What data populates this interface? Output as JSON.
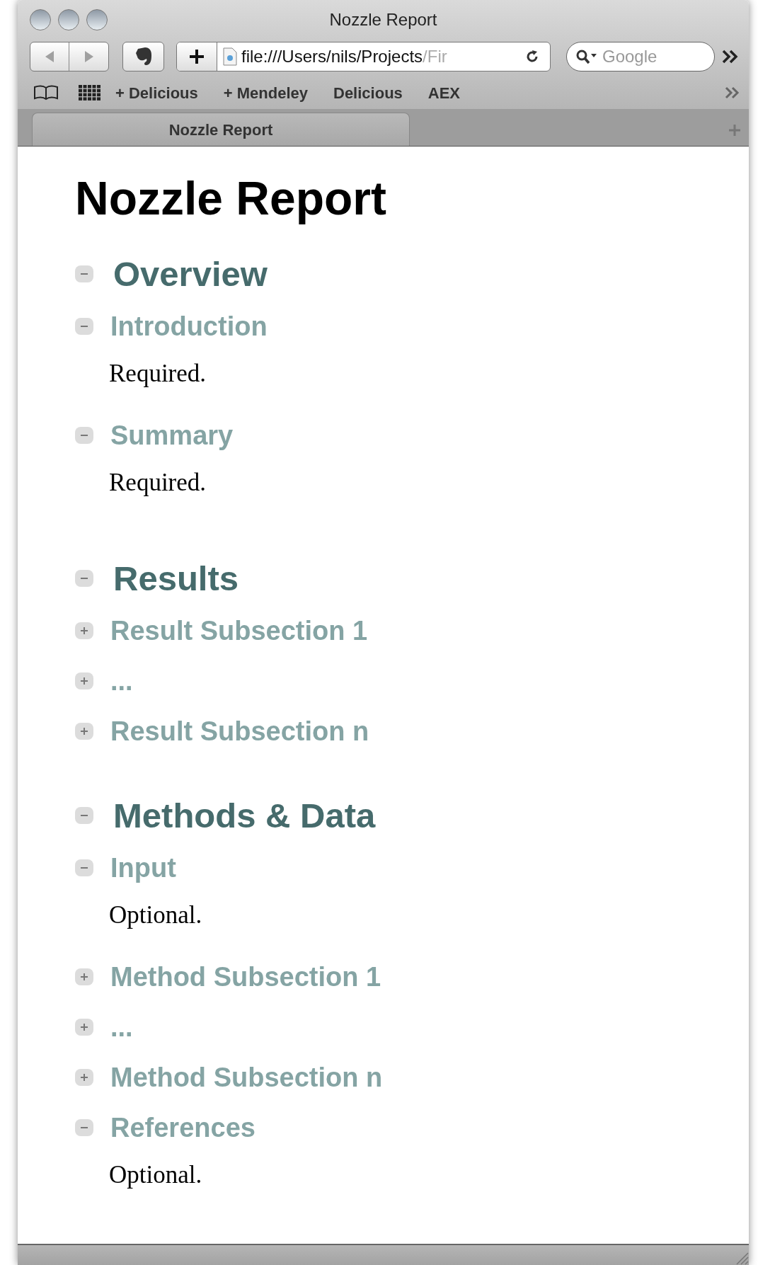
{
  "window": {
    "title": "Nozzle Report"
  },
  "toolbar": {
    "url": "file:///Users/nils/Projects",
    "url_faded": "/Fir",
    "search": {
      "placeholder": "Google"
    }
  },
  "bookmarks": [
    "+ Delicious",
    "+ Mendeley",
    "Delicious",
    "AEX"
  ],
  "tabs": [
    {
      "label": "Nozzle Report",
      "selected": true
    }
  ],
  "page": {
    "title": "Nozzle Report",
    "sections": [
      {
        "heading": "Overview",
        "expanded": true,
        "children": [
          {
            "heading": "Introduction",
            "expanded": true,
            "body": "Required."
          },
          {
            "heading": "Summary",
            "expanded": true,
            "body": "Required."
          }
        ]
      },
      {
        "heading": "Results",
        "expanded": true,
        "children": [
          {
            "heading": "Result Subsection 1",
            "expanded": false
          },
          {
            "heading": "...",
            "expanded": false
          },
          {
            "heading": "Result Subsection n",
            "expanded": false
          }
        ]
      },
      {
        "heading": "Methods & Data",
        "expanded": true,
        "children": [
          {
            "heading": "Input",
            "expanded": true,
            "body": "Optional."
          },
          {
            "heading": "Method Subsection 1",
            "expanded": false
          },
          {
            "heading": "...",
            "expanded": false
          },
          {
            "heading": "Method Subsection n",
            "expanded": false
          },
          {
            "heading": "References",
            "expanded": true,
            "body": "Optional."
          }
        ]
      }
    ]
  }
}
